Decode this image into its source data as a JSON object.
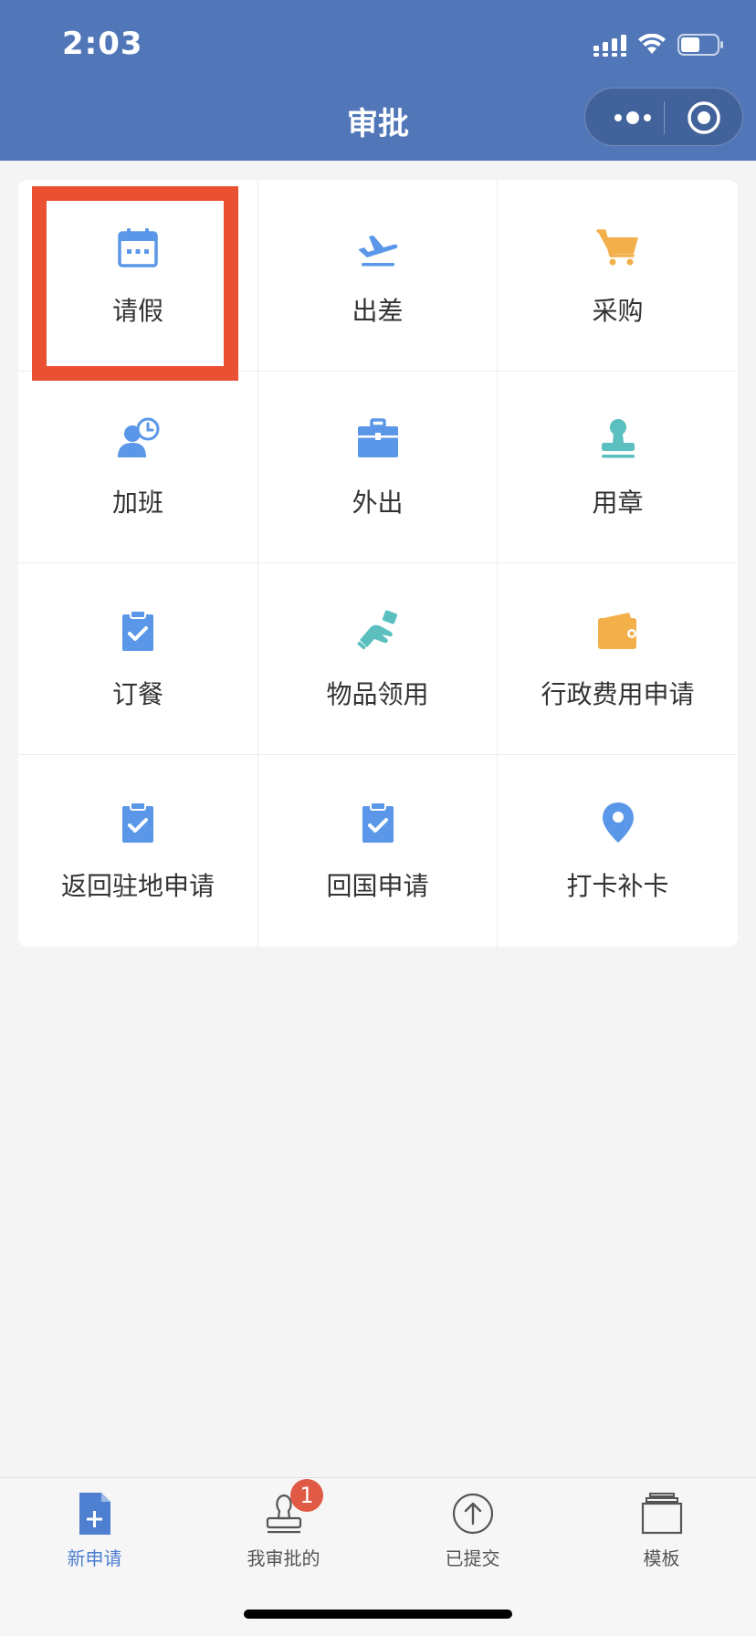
{
  "status_bar": {
    "time": "2:03"
  },
  "nav": {
    "title": "审批"
  },
  "grid": {
    "items": [
      {
        "label": "请假",
        "icon": "calendar-icon",
        "color": "#5b97e8"
      },
      {
        "label": "出差",
        "icon": "airplane-icon",
        "color": "#5b97e8"
      },
      {
        "label": "采购",
        "icon": "cart-icon",
        "color": "#f3b04a"
      },
      {
        "label": "加班",
        "icon": "person-clock-icon",
        "color": "#5b97e8"
      },
      {
        "label": "外出",
        "icon": "briefcase-icon",
        "color": "#5b97e8"
      },
      {
        "label": "用章",
        "icon": "stamp-icon",
        "color": "#5bbfbf"
      },
      {
        "label": "订餐",
        "icon": "clipboard-check-icon",
        "color": "#5b97e8"
      },
      {
        "label": "物品领用",
        "icon": "hand-receive-icon",
        "color": "#5bbfbf"
      },
      {
        "label": "行政费用申请",
        "icon": "wallet-icon",
        "color": "#f3b04a"
      },
      {
        "label": "返回驻地申请",
        "icon": "clipboard-check-icon",
        "color": "#5b97e8"
      },
      {
        "label": "回国申请",
        "icon": "clipboard-check-icon",
        "color": "#5b97e8"
      },
      {
        "label": "打卡补卡",
        "icon": "location-pin-icon",
        "color": "#5b97e8"
      }
    ]
  },
  "tabs": [
    {
      "label": "新申请",
      "icon": "new-document-icon",
      "active": true
    },
    {
      "label": "我审批的",
      "icon": "stamp-outline-icon",
      "active": false
    },
    {
      "label": "已提交",
      "icon": "upload-circle-icon",
      "active": false
    },
    {
      "label": "模板",
      "icon": "template-stack-icon",
      "active": false
    }
  ],
  "badges": {
    "approvals_count": "1"
  },
  "colors": {
    "header": "#5177b8",
    "highlight": "#ea5133",
    "active_tab": "#4e7fd0",
    "badge": "#e05a46"
  }
}
